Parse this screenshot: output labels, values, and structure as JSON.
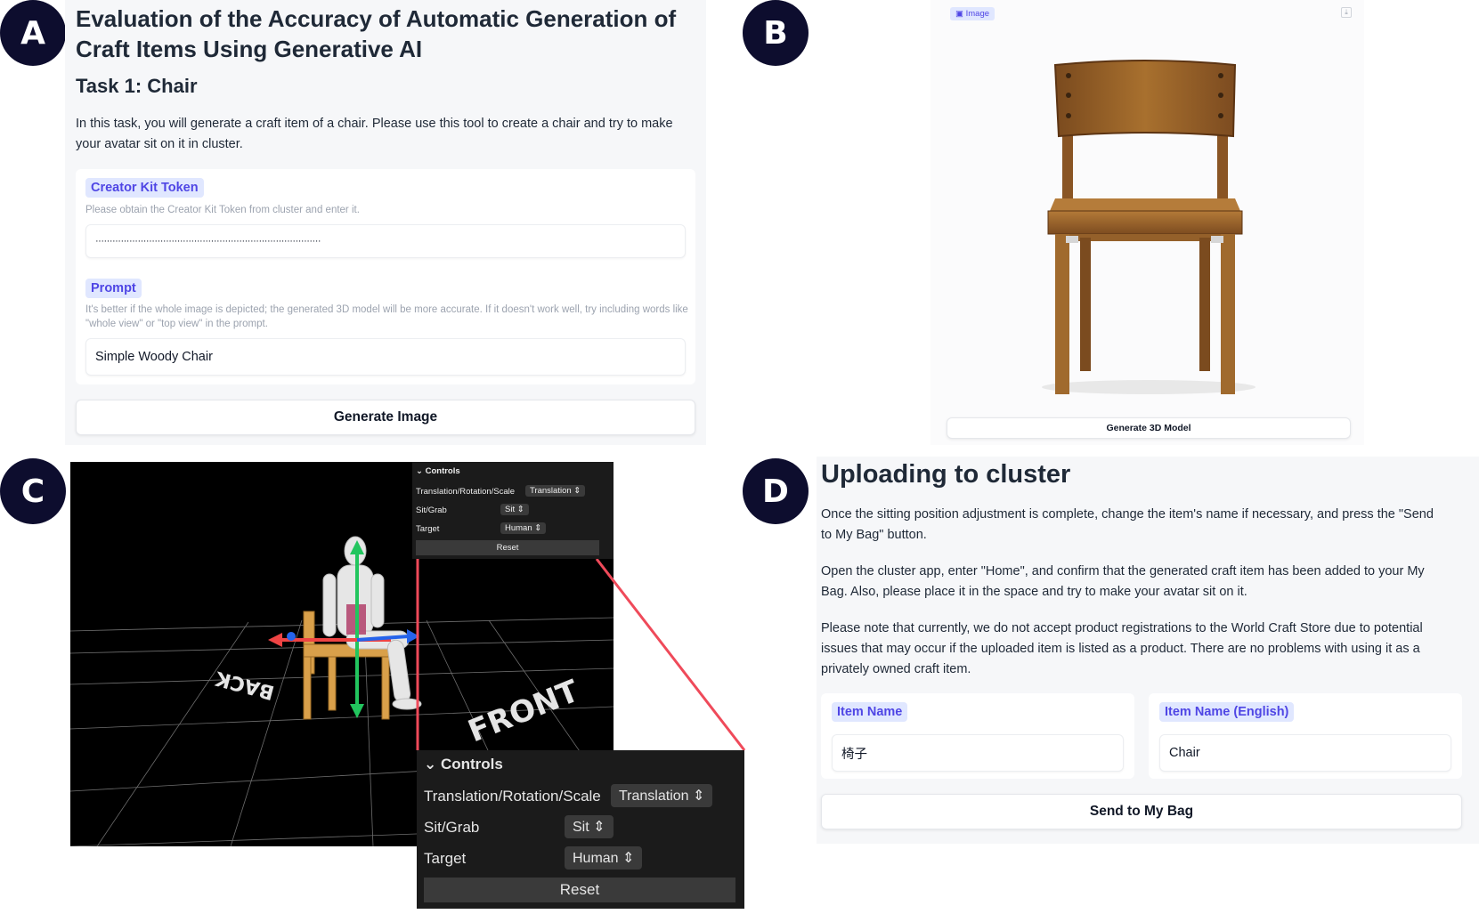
{
  "badges": [
    "A",
    "B",
    "C",
    "D"
  ],
  "panel_a": {
    "title": "Evaluation of the Accuracy of Automatic Generation of Craft Items Using Generative AI",
    "task_heading": "Task 1: Chair",
    "description": "In this task, you will generate a craft item of a chair. Please use this tool to create a chair and try to make your avatar sit on it in cluster.",
    "token_label": "Creator Kit Token",
    "token_hint": "Please obtain the Creator Kit Token from cluster and enter it.",
    "token_value": "················································································",
    "prompt_label": "Prompt",
    "prompt_hint": "It's better if the whole image is depicted; the generated 3D model will be more accurate. If it doesn't work well, try including words like \"whole view\" or \"top view\" in the prompt.",
    "prompt_value": "Simple Woody Chair",
    "generate_button": "Generate Image"
  },
  "panel_b": {
    "image_tag": "Image",
    "generate_button": "Generate 3D Model"
  },
  "panel_c": {
    "controls_title": "Controls",
    "rows": [
      {
        "label": "Translation/Rotation/Scale",
        "value": "Translation"
      },
      {
        "label": "Sit/Grab",
        "value": "Sit"
      },
      {
        "label": "Target",
        "value": "Human"
      }
    ],
    "reset_button": "Reset",
    "floor_text_back": "BACK",
    "floor_text_front": "FRONT"
  },
  "panel_d": {
    "heading": "Uploading to cluster",
    "para1": "Once the sitting position adjustment is complete, change the item's name if necessary, and press the \"Send to My Bag\" button.",
    "para2": "Open the cluster app, enter \"Home\", and confirm that the generated craft item has been added to your My Bag. Also, please place it in the space and try to make your avatar sit on it.",
    "para3": "Please note that currently, we do not accept product registrations to the World Craft Store due to potential issues that may occur if the uploaded item is listed as a product. There are no problems with using it as a privately owned craft item.",
    "item_name_label": "Item Name",
    "item_name_value": "椅子",
    "item_name_en_label": "Item Name (English)",
    "item_name_en_value": "Chair",
    "send_button": "Send to My Bag"
  }
}
